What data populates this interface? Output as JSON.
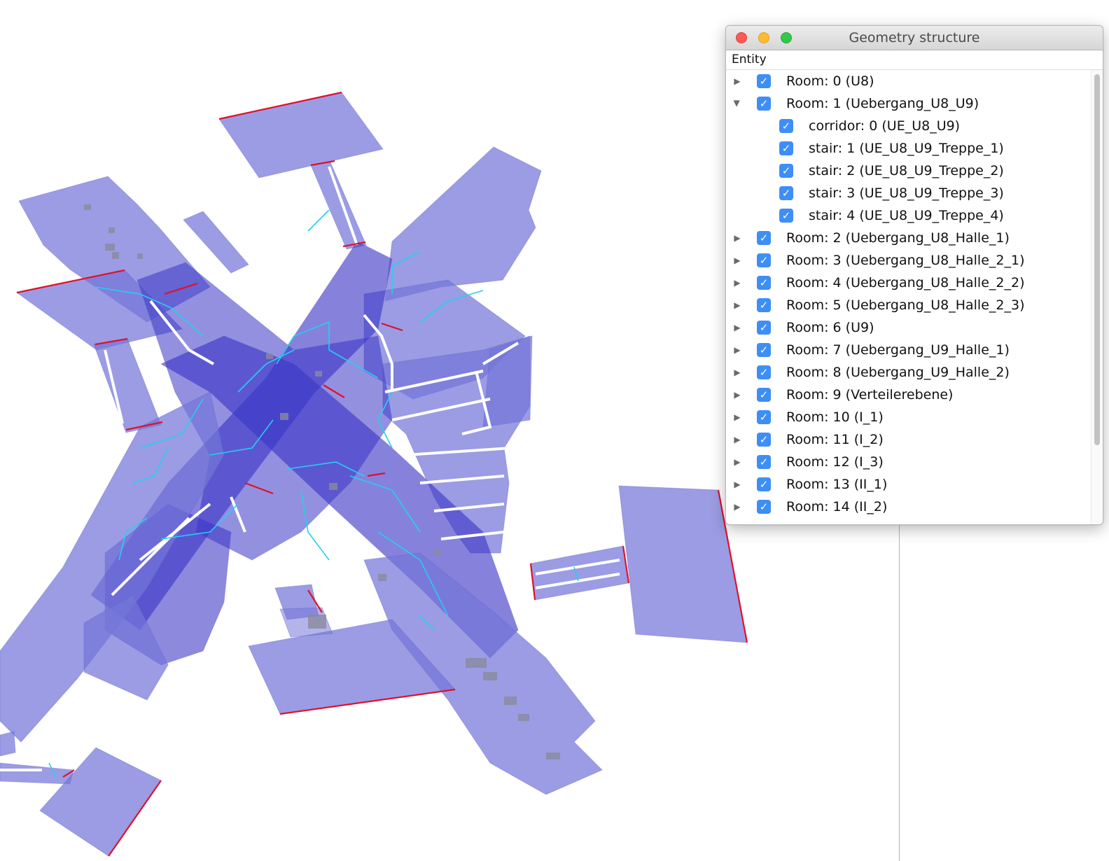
{
  "window": {
    "title": "Geometry structure"
  },
  "tree": {
    "header": "Entity",
    "rows": [
      {
        "label": "Room: 0 (U8)",
        "level": 0,
        "expanded": false,
        "checked": true
      },
      {
        "label": "Room: 1 (Uebergang_U8_U9)",
        "level": 0,
        "expanded": true,
        "checked": true
      },
      {
        "label": "corridor: 0 (UE_U8_U9)",
        "level": 1,
        "checked": true
      },
      {
        "label": "stair: 1 (UE_U8_U9_Treppe_1)",
        "level": 1,
        "checked": true
      },
      {
        "label": "stair: 2 (UE_U8_U9_Treppe_2)",
        "level": 1,
        "checked": true
      },
      {
        "label": "stair: 3 (UE_U8_U9_Treppe_3)",
        "level": 1,
        "checked": true
      },
      {
        "label": "stair: 4 (UE_U8_U9_Treppe_4)",
        "level": 1,
        "checked": true
      },
      {
        "label": "Room: 2 (Uebergang_U8_Halle_1)",
        "level": 0,
        "expanded": false,
        "checked": true
      },
      {
        "label": "Room: 3 (Uebergang_U8_Halle_2_1)",
        "level": 0,
        "expanded": false,
        "checked": true
      },
      {
        "label": "Room: 4 (Uebergang_U8_Halle_2_2)",
        "level": 0,
        "expanded": false,
        "checked": true
      },
      {
        "label": "Room: 5 (Uebergang_U8_Halle_2_3)",
        "level": 0,
        "expanded": false,
        "checked": true
      },
      {
        "label": "Room: 6 (U9)",
        "level": 0,
        "expanded": false,
        "checked": true
      },
      {
        "label": "Room: 7 (Uebergang_U9_Halle_1)",
        "level": 0,
        "expanded": false,
        "checked": true
      },
      {
        "label": "Room: 8 (Uebergang_U9_Halle_2)",
        "level": 0,
        "expanded": false,
        "checked": true
      },
      {
        "label": "Room: 9 (Verteilerebene)",
        "level": 0,
        "expanded": false,
        "checked": true
      },
      {
        "label": "Room: 10 (I_1)",
        "level": 0,
        "expanded": false,
        "checked": true
      },
      {
        "label": "Room: 11 (I_2)",
        "level": 0,
        "expanded": false,
        "checked": true
      },
      {
        "label": "Room: 12 (I_3)",
        "level": 0,
        "expanded": false,
        "checked": true
      },
      {
        "label": "Room: 13 (II_1)",
        "level": 0,
        "expanded": false,
        "checked": true
      },
      {
        "label": "Room: 14 (II_2)",
        "level": 0,
        "expanded": false,
        "checked": true
      }
    ]
  },
  "colors": {
    "floor_fill": "#7174d6",
    "floor_dark": "#3a34c8",
    "edge_red": "#e0102a",
    "edge_cyan": "#22d0f0",
    "checkbox": "#3d8ef7"
  }
}
